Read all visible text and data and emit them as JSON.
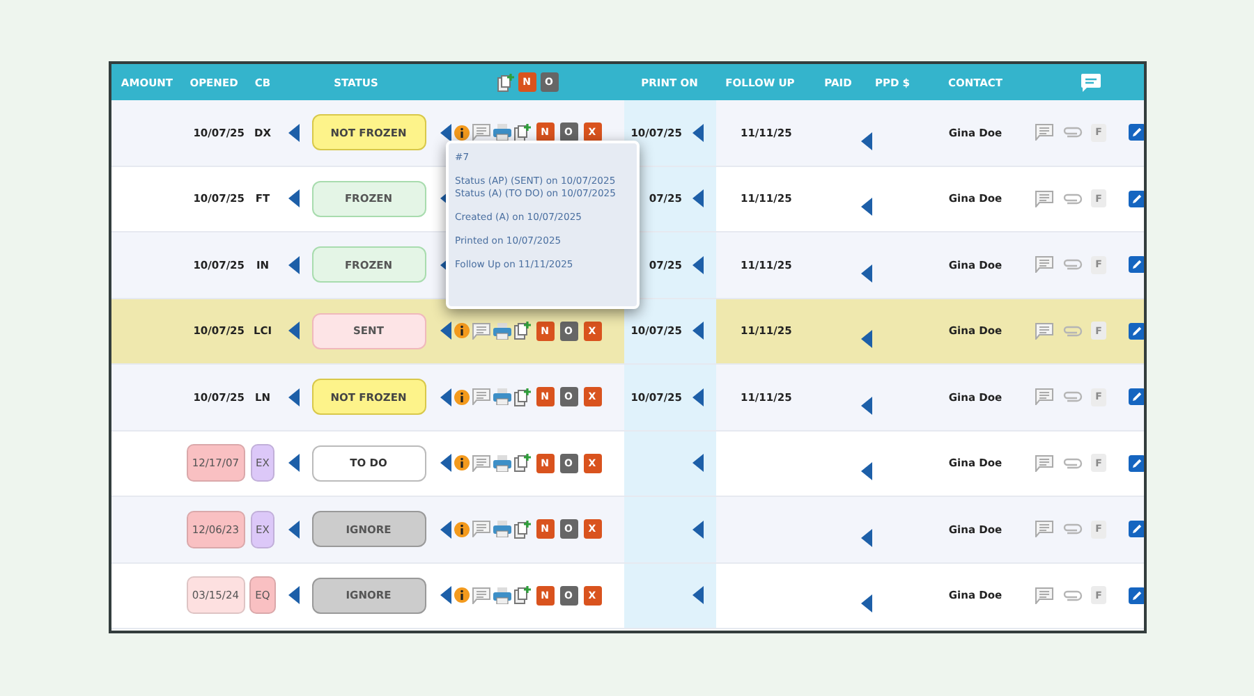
{
  "header": {
    "columns": [
      {
        "label": "AMOUNT",
        "kind": "text"
      },
      {
        "label": "OPENED",
        "kind": "text"
      },
      {
        "label": "CB",
        "kind": "text"
      },
      {
        "label": "STATUS",
        "kind": "status"
      },
      {
        "kind": "actions"
      },
      {
        "label": "PRINT ON",
        "kind": "text"
      },
      {
        "label": "FOLLOW UP",
        "kind": "text"
      },
      {
        "label": "PAID",
        "kind": "text"
      },
      {
        "label": "PPD $",
        "kind": "text"
      },
      {
        "label": "CONTACT",
        "kind": "text"
      },
      {
        "kind": "chat"
      }
    ],
    "action_buttons": [
      {
        "label": "N",
        "kind": "accent"
      },
      {
        "label": "O",
        "kind": "neutral"
      }
    ]
  },
  "rows": [
    {
      "opened": {
        "text": "10/07/25"
      },
      "cb": {
        "text": "DX"
      },
      "status": {
        "label": "NOT FROZEN",
        "kind": "not_frozen"
      },
      "buttons": [
        {
          "label": "N",
          "kind": "accent"
        },
        {
          "label": "O",
          "kind": "neutral"
        },
        {
          "label": "X",
          "kind": "accent"
        }
      ],
      "print_on": "10/07/25",
      "follow_up": "11/11/25",
      "contact": "Gina Doe",
      "flag": "F",
      "highlighted": false
    },
    {
      "opened": {
        "text": "10/07/25"
      },
      "cb": {
        "text": "FT"
      },
      "status": {
        "label": "FROZEN",
        "kind": "frozen"
      },
      "print_on": "07/25",
      "follow_up": "11/11/25",
      "contact": "Gina Doe",
      "flag": "F",
      "highlighted": false
    },
    {
      "opened": {
        "text": "10/07/25"
      },
      "cb": {
        "text": "IN"
      },
      "status": {
        "label": "FROZEN",
        "kind": "frozen"
      },
      "print_on": "07/25",
      "follow_up": "11/11/25",
      "contact": "Gina Doe",
      "flag": "F",
      "highlighted": false
    },
    {
      "opened": {
        "text": "10/07/25"
      },
      "cb": {
        "text": "LCI"
      },
      "status": {
        "label": "SENT",
        "kind": "sent"
      },
      "buttons": [
        {
          "label": "N",
          "kind": "accent"
        },
        {
          "label": "O",
          "kind": "neutral"
        },
        {
          "label": "X",
          "kind": "accent"
        }
      ],
      "print_on": "10/07/25",
      "follow_up": "11/11/25",
      "contact": "Gina Doe",
      "flag": "F",
      "highlighted": true
    },
    {
      "opened": {
        "text": "10/07/25"
      },
      "cb": {
        "text": "LN"
      },
      "status": {
        "label": "NOT FROZEN",
        "kind": "not_frozen"
      },
      "buttons": [
        {
          "label": "N",
          "kind": "accent"
        },
        {
          "label": "O",
          "kind": "neutral"
        },
        {
          "label": "X",
          "kind": "accent"
        }
      ],
      "print_on": "10/07/25",
      "follow_up": "11/11/25",
      "contact": "Gina Doe",
      "flag": "F",
      "highlighted": false
    },
    {
      "opened": {
        "text": "12/17/07",
        "color": "#f9c0c2"
      },
      "cb": {
        "text": "EX",
        "color": "#dcc8f8"
      },
      "status": {
        "label": "TO DO",
        "kind": "todo"
      },
      "buttons": [
        {
          "label": "N",
          "kind": "accent"
        },
        {
          "label": "O",
          "kind": "neutral"
        },
        {
          "label": "X",
          "kind": "accent"
        }
      ],
      "contact": "Gina Doe",
      "flag": "F",
      "highlighted": false
    },
    {
      "opened": {
        "text": "12/06/23",
        "color": "#f9c0c2"
      },
      "cb": {
        "text": "EX",
        "color": "#dcc8f8"
      },
      "status": {
        "label": "IGNORE",
        "kind": "ignore"
      },
      "buttons": [
        {
          "label": "N",
          "kind": "accent"
        },
        {
          "label": "O",
          "kind": "neutral"
        },
        {
          "label": "X",
          "kind": "accent"
        }
      ],
      "contact": "Gina Doe",
      "flag": "F",
      "highlighted": false
    },
    {
      "opened": {
        "text": "03/15/24",
        "color": "#fde0e0"
      },
      "cb": {
        "text": "EQ",
        "color": "#f9c0c2"
      },
      "status": {
        "label": "IGNORE",
        "kind": "ignore"
      },
      "buttons": [
        {
          "label": "N",
          "kind": "accent"
        },
        {
          "label": "O",
          "kind": "neutral"
        },
        {
          "label": "X",
          "kind": "accent"
        }
      ],
      "contact": "Gina Doe",
      "flag": "F",
      "highlighted": false
    }
  ],
  "tooltip": {
    "groups": [
      [
        "#7"
      ],
      [
        "Status (AP) (SENT) on 10/07/2025",
        "Status (A) (TO DO) on 10/07/2025"
      ],
      [
        "Created (A) on 10/07/2025"
      ],
      [
        "Printed on 10/07/2025"
      ],
      [
        "Follow Up on 11/11/2025"
      ]
    ]
  }
}
